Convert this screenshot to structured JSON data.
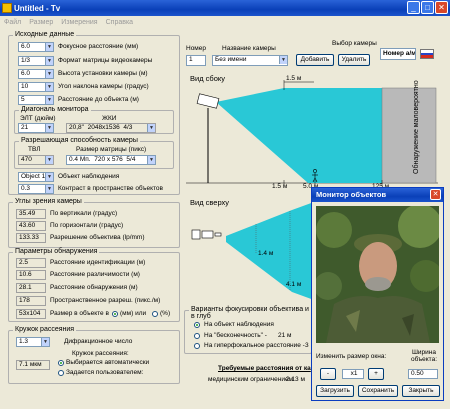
{
  "window": {
    "title": "Untitled - Tv",
    "minimize": "_",
    "maximize": "□",
    "close": "✕"
  },
  "menu": [
    "Файл",
    "Размер",
    "Измерения",
    "Справка"
  ],
  "source": {
    "title": "Исходные данные",
    "rows": [
      {
        "value": "6.0",
        "label": "Фокусное расстояние (мм)"
      },
      {
        "value": "1/3",
        "label": "Формат матрицы видеокамеры"
      },
      {
        "value": "6.0",
        "label": "Высота установки камеры (м)"
      },
      {
        "value": "10",
        "label": "Угол наклона камеры (градус)"
      },
      {
        "value": "5",
        "label": "Расстояние до объекта (м)"
      }
    ],
    "diag_title": "Диагональ монитора",
    "elt_label": "ЭЛТ (дюйм)",
    "lcd_label": "ЖКИ",
    "elt_value": "21",
    "lcd_size": "20,8\"",
    "lcd_res": "2048x1536",
    "lcd_ratio": "4/3",
    "res_title": "Разрешающая способность камеры",
    "tvl_label": "ТВЛ",
    "matrix_label": "Размер матрицы (пикс)",
    "tvl_value": "470",
    "matrix_mp": "0.4 Мп.",
    "matrix_size": "720 x 576",
    "matrix_ratio": "5/4",
    "object_value": "Object 1x",
    "object_label": "Объект наблюдения",
    "contrast_value": "0.3",
    "contrast_label": "Контраст в пространстве объектов"
  },
  "angles": {
    "title": "Углы зрения камеры",
    "rows": [
      {
        "value": "35.49",
        "label": "По вертикали (градус)"
      },
      {
        "value": "43.60",
        "label": "По горизонтали (градус)"
      },
      {
        "value": "133.33",
        "label": "Разрешение объектива (lp/mm)"
      }
    ]
  },
  "detection": {
    "title": "Параметры обнаружения",
    "rows": [
      {
        "value": "2.5",
        "label": "Расстояние идентификации (м)"
      },
      {
        "value": "10.6",
        "label": "Расстояние различимости (м)"
      },
      {
        "value": "28.1",
        "label": "Расстояние обнаружения (м)"
      },
      {
        "value": "178",
        "label": "Пространственное разреш. (пикс./м)"
      }
    ],
    "size_value": "53x104",
    "size_label": "Размер в объекте в",
    "unit_mm": "(мм) или",
    "unit_pct": "(%)"
  },
  "coc": {
    "title": "Кружок рассеяния",
    "value": "1.3",
    "diffraction_label": "Дифракционное число",
    "coc_label": "Кружок рассеяния:",
    "coc_value": "7.1 мкм",
    "auto_label": "Выбирается автоматически",
    "user_label": "Задается пользователем:"
  },
  "camera": {
    "select_title": "Выбор камеры",
    "number_label": "Номер",
    "name_label": "Название камеры",
    "number_value": "1",
    "name_value": "Без имени",
    "add_label": "Добавить",
    "delete_label": "Удалить",
    "number_am_label": "Номер а/м"
  },
  "side_view": {
    "title": "Вид сбоку",
    "top_dist": "1.5 м",
    "tick1": "1.5 м",
    "tick2": "5.0 м",
    "tick3": "125 м",
    "zone_label": "Обнаружение маловероятно"
  },
  "top_view": {
    "title": "Вид сверху",
    "width1": "1.4 м",
    "width2": "4.1 м"
  },
  "focus": {
    "title": "Варианты фокусировки объектива и в глуб",
    "options": [
      "На объект наблюдения",
      "На \"бесконечность\" -",
      "На гиперфокальное расстояние -"
    ],
    "inf_value": "21 м",
    "hyper_value": "3"
  },
  "req": {
    "title": "Требуемые расстояния от ка",
    "note": "медицинским ограничением",
    "note_value": "2.13 м"
  },
  "monitor": {
    "title": "Монитор объектов",
    "resize_label": "Изменить размер окна:",
    "width_label": "Ширина объекта:",
    "zoom_value": "x1",
    "minus_label": "-",
    "plus_label": "+",
    "width_value": "0.50",
    "load_label": "Загрузить",
    "save_label": "Сохранить",
    "close_label": "Закрыть"
  }
}
